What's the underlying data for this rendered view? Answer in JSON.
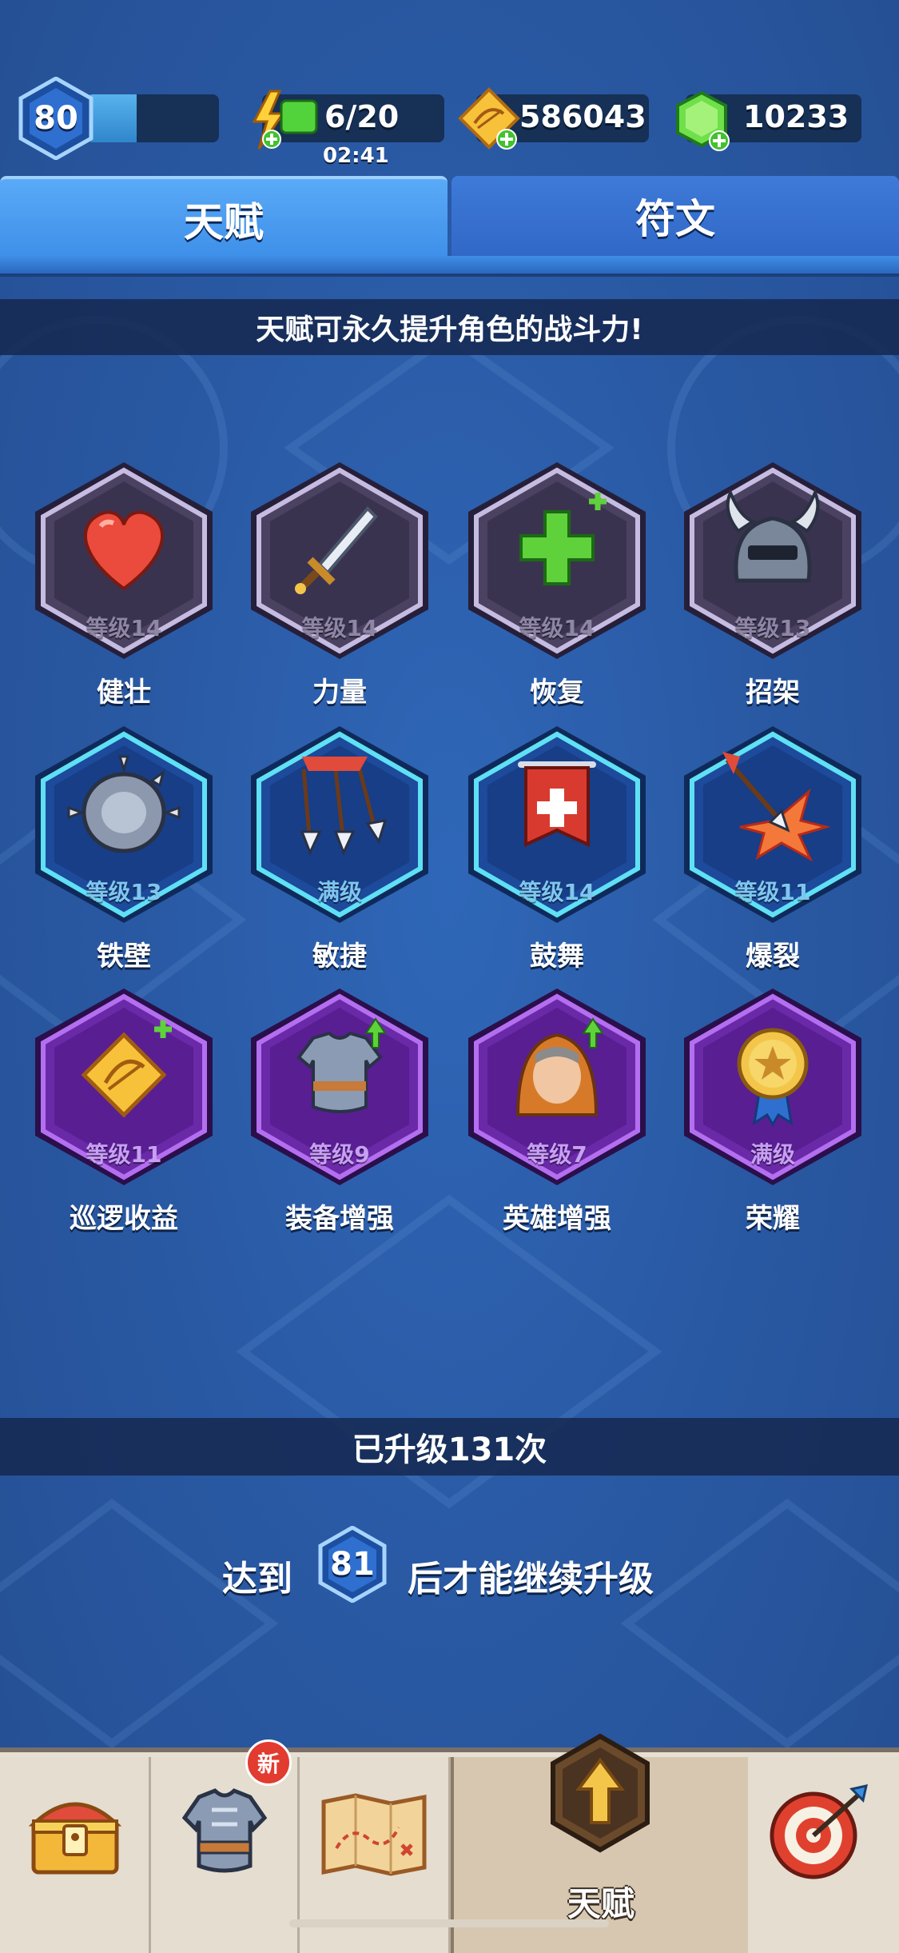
{
  "colors": {
    "tier_gray_border": "#c6bbe0",
    "tier_cyan_border": "#5fe0f5",
    "tier_purple_border": "#b46ef0",
    "level_text_gray": "#8f86a6",
    "level_text_cyan": "#7fc6ee",
    "level_text_purple": "#c7a0f2"
  },
  "status": {
    "player_level": "80",
    "xp_progress": 0.38,
    "energy": "6/20",
    "energy_timer": "02:41",
    "gold": "586043",
    "gems": "10233"
  },
  "tabs": [
    {
      "label": "天赋",
      "active": true
    },
    {
      "label": "符文",
      "active": false
    }
  ],
  "banner_text": "天赋可永久提升角色的战斗力!",
  "talents": [
    {
      "name": "健壮",
      "level": "等级14",
      "tier": "gray",
      "icon": "heart-icon"
    },
    {
      "name": "力量",
      "level": "等级14",
      "tier": "gray",
      "icon": "sword-icon"
    },
    {
      "name": "恢复",
      "level": "等级14",
      "tier": "gray",
      "icon": "heal-plus-icon"
    },
    {
      "name": "招架",
      "level": "等级13",
      "tier": "gray",
      "icon": "horned-helmet-icon"
    },
    {
      "name": "铁壁",
      "level": "等级13",
      "tier": "cyan",
      "icon": "spiked-shield-icon"
    },
    {
      "name": "敏捷",
      "level": "满级",
      "tier": "cyan",
      "icon": "triple-arrow-icon"
    },
    {
      "name": "鼓舞",
      "level": "等级14",
      "tier": "cyan",
      "icon": "banner-icon"
    },
    {
      "name": "爆裂",
      "level": "等级11",
      "tier": "cyan",
      "icon": "exploding-arrow-icon"
    },
    {
      "name": "巡逻收益",
      "level": "等级11",
      "tier": "purple",
      "icon": "gold-coin-icon"
    },
    {
      "name": "装备增强",
      "level": "等级9",
      "tier": "purple",
      "icon": "armor-icon"
    },
    {
      "name": "英雄增强",
      "level": "等级7",
      "tier": "purple",
      "icon": "hooded-hero-icon"
    },
    {
      "name": "荣耀",
      "level": "满级",
      "tier": "purple",
      "icon": "star-medal-icon"
    }
  ],
  "upgrade_count_text": "已升级131次",
  "unlock": {
    "prefix": "达到",
    "level": "81",
    "suffix": "后才能继续升级"
  },
  "nav": [
    {
      "icon": "treasure-chest-icon",
      "label": "",
      "active": false
    },
    {
      "icon": "armor-icon",
      "label": "",
      "active": false,
      "badge": "新"
    },
    {
      "icon": "map-icon",
      "label": "",
      "active": false
    },
    {
      "icon": "talent-arrow-icon",
      "label": "天赋",
      "active": true
    },
    {
      "icon": "target-icon",
      "label": "",
      "active": false
    }
  ]
}
